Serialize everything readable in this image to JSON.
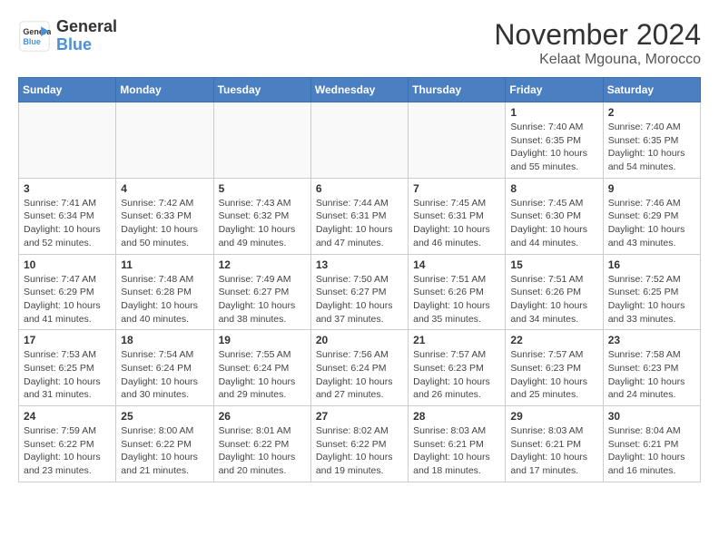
{
  "header": {
    "logo_line1": "General",
    "logo_line2": "Blue",
    "month_title": "November 2024",
    "location": "Kelaat Mgouna, Morocco"
  },
  "weekdays": [
    "Sunday",
    "Monday",
    "Tuesday",
    "Wednesday",
    "Thursday",
    "Friday",
    "Saturday"
  ],
  "weeks": [
    [
      {
        "day": "",
        "info": ""
      },
      {
        "day": "",
        "info": ""
      },
      {
        "day": "",
        "info": ""
      },
      {
        "day": "",
        "info": ""
      },
      {
        "day": "",
        "info": ""
      },
      {
        "day": "1",
        "info": "Sunrise: 7:40 AM\nSunset: 6:35 PM\nDaylight: 10 hours\nand 55 minutes."
      },
      {
        "day": "2",
        "info": "Sunrise: 7:40 AM\nSunset: 6:35 PM\nDaylight: 10 hours\nand 54 minutes."
      }
    ],
    [
      {
        "day": "3",
        "info": "Sunrise: 7:41 AM\nSunset: 6:34 PM\nDaylight: 10 hours\nand 52 minutes."
      },
      {
        "day": "4",
        "info": "Sunrise: 7:42 AM\nSunset: 6:33 PM\nDaylight: 10 hours\nand 50 minutes."
      },
      {
        "day": "5",
        "info": "Sunrise: 7:43 AM\nSunset: 6:32 PM\nDaylight: 10 hours\nand 49 minutes."
      },
      {
        "day": "6",
        "info": "Sunrise: 7:44 AM\nSunset: 6:31 PM\nDaylight: 10 hours\nand 47 minutes."
      },
      {
        "day": "7",
        "info": "Sunrise: 7:45 AM\nSunset: 6:31 PM\nDaylight: 10 hours\nand 46 minutes."
      },
      {
        "day": "8",
        "info": "Sunrise: 7:45 AM\nSunset: 6:30 PM\nDaylight: 10 hours\nand 44 minutes."
      },
      {
        "day": "9",
        "info": "Sunrise: 7:46 AM\nSunset: 6:29 PM\nDaylight: 10 hours\nand 43 minutes."
      }
    ],
    [
      {
        "day": "10",
        "info": "Sunrise: 7:47 AM\nSunset: 6:29 PM\nDaylight: 10 hours\nand 41 minutes."
      },
      {
        "day": "11",
        "info": "Sunrise: 7:48 AM\nSunset: 6:28 PM\nDaylight: 10 hours\nand 40 minutes."
      },
      {
        "day": "12",
        "info": "Sunrise: 7:49 AM\nSunset: 6:27 PM\nDaylight: 10 hours\nand 38 minutes."
      },
      {
        "day": "13",
        "info": "Sunrise: 7:50 AM\nSunset: 6:27 PM\nDaylight: 10 hours\nand 37 minutes."
      },
      {
        "day": "14",
        "info": "Sunrise: 7:51 AM\nSunset: 6:26 PM\nDaylight: 10 hours\nand 35 minutes."
      },
      {
        "day": "15",
        "info": "Sunrise: 7:51 AM\nSunset: 6:26 PM\nDaylight: 10 hours\nand 34 minutes."
      },
      {
        "day": "16",
        "info": "Sunrise: 7:52 AM\nSunset: 6:25 PM\nDaylight: 10 hours\nand 33 minutes."
      }
    ],
    [
      {
        "day": "17",
        "info": "Sunrise: 7:53 AM\nSunset: 6:25 PM\nDaylight: 10 hours\nand 31 minutes."
      },
      {
        "day": "18",
        "info": "Sunrise: 7:54 AM\nSunset: 6:24 PM\nDaylight: 10 hours\nand 30 minutes."
      },
      {
        "day": "19",
        "info": "Sunrise: 7:55 AM\nSunset: 6:24 PM\nDaylight: 10 hours\nand 29 minutes."
      },
      {
        "day": "20",
        "info": "Sunrise: 7:56 AM\nSunset: 6:24 PM\nDaylight: 10 hours\nand 27 minutes."
      },
      {
        "day": "21",
        "info": "Sunrise: 7:57 AM\nSunset: 6:23 PM\nDaylight: 10 hours\nand 26 minutes."
      },
      {
        "day": "22",
        "info": "Sunrise: 7:57 AM\nSunset: 6:23 PM\nDaylight: 10 hours\nand 25 minutes."
      },
      {
        "day": "23",
        "info": "Sunrise: 7:58 AM\nSunset: 6:23 PM\nDaylight: 10 hours\nand 24 minutes."
      }
    ],
    [
      {
        "day": "24",
        "info": "Sunrise: 7:59 AM\nSunset: 6:22 PM\nDaylight: 10 hours\nand 23 minutes."
      },
      {
        "day": "25",
        "info": "Sunrise: 8:00 AM\nSunset: 6:22 PM\nDaylight: 10 hours\nand 21 minutes."
      },
      {
        "day": "26",
        "info": "Sunrise: 8:01 AM\nSunset: 6:22 PM\nDaylight: 10 hours\nand 20 minutes."
      },
      {
        "day": "27",
        "info": "Sunrise: 8:02 AM\nSunset: 6:22 PM\nDaylight: 10 hours\nand 19 minutes."
      },
      {
        "day": "28",
        "info": "Sunrise: 8:03 AM\nSunset: 6:21 PM\nDaylight: 10 hours\nand 18 minutes."
      },
      {
        "day": "29",
        "info": "Sunrise: 8:03 AM\nSunset: 6:21 PM\nDaylight: 10 hours\nand 17 minutes."
      },
      {
        "day": "30",
        "info": "Sunrise: 8:04 AM\nSunset: 6:21 PM\nDaylight: 10 hours\nand 16 minutes."
      }
    ]
  ]
}
